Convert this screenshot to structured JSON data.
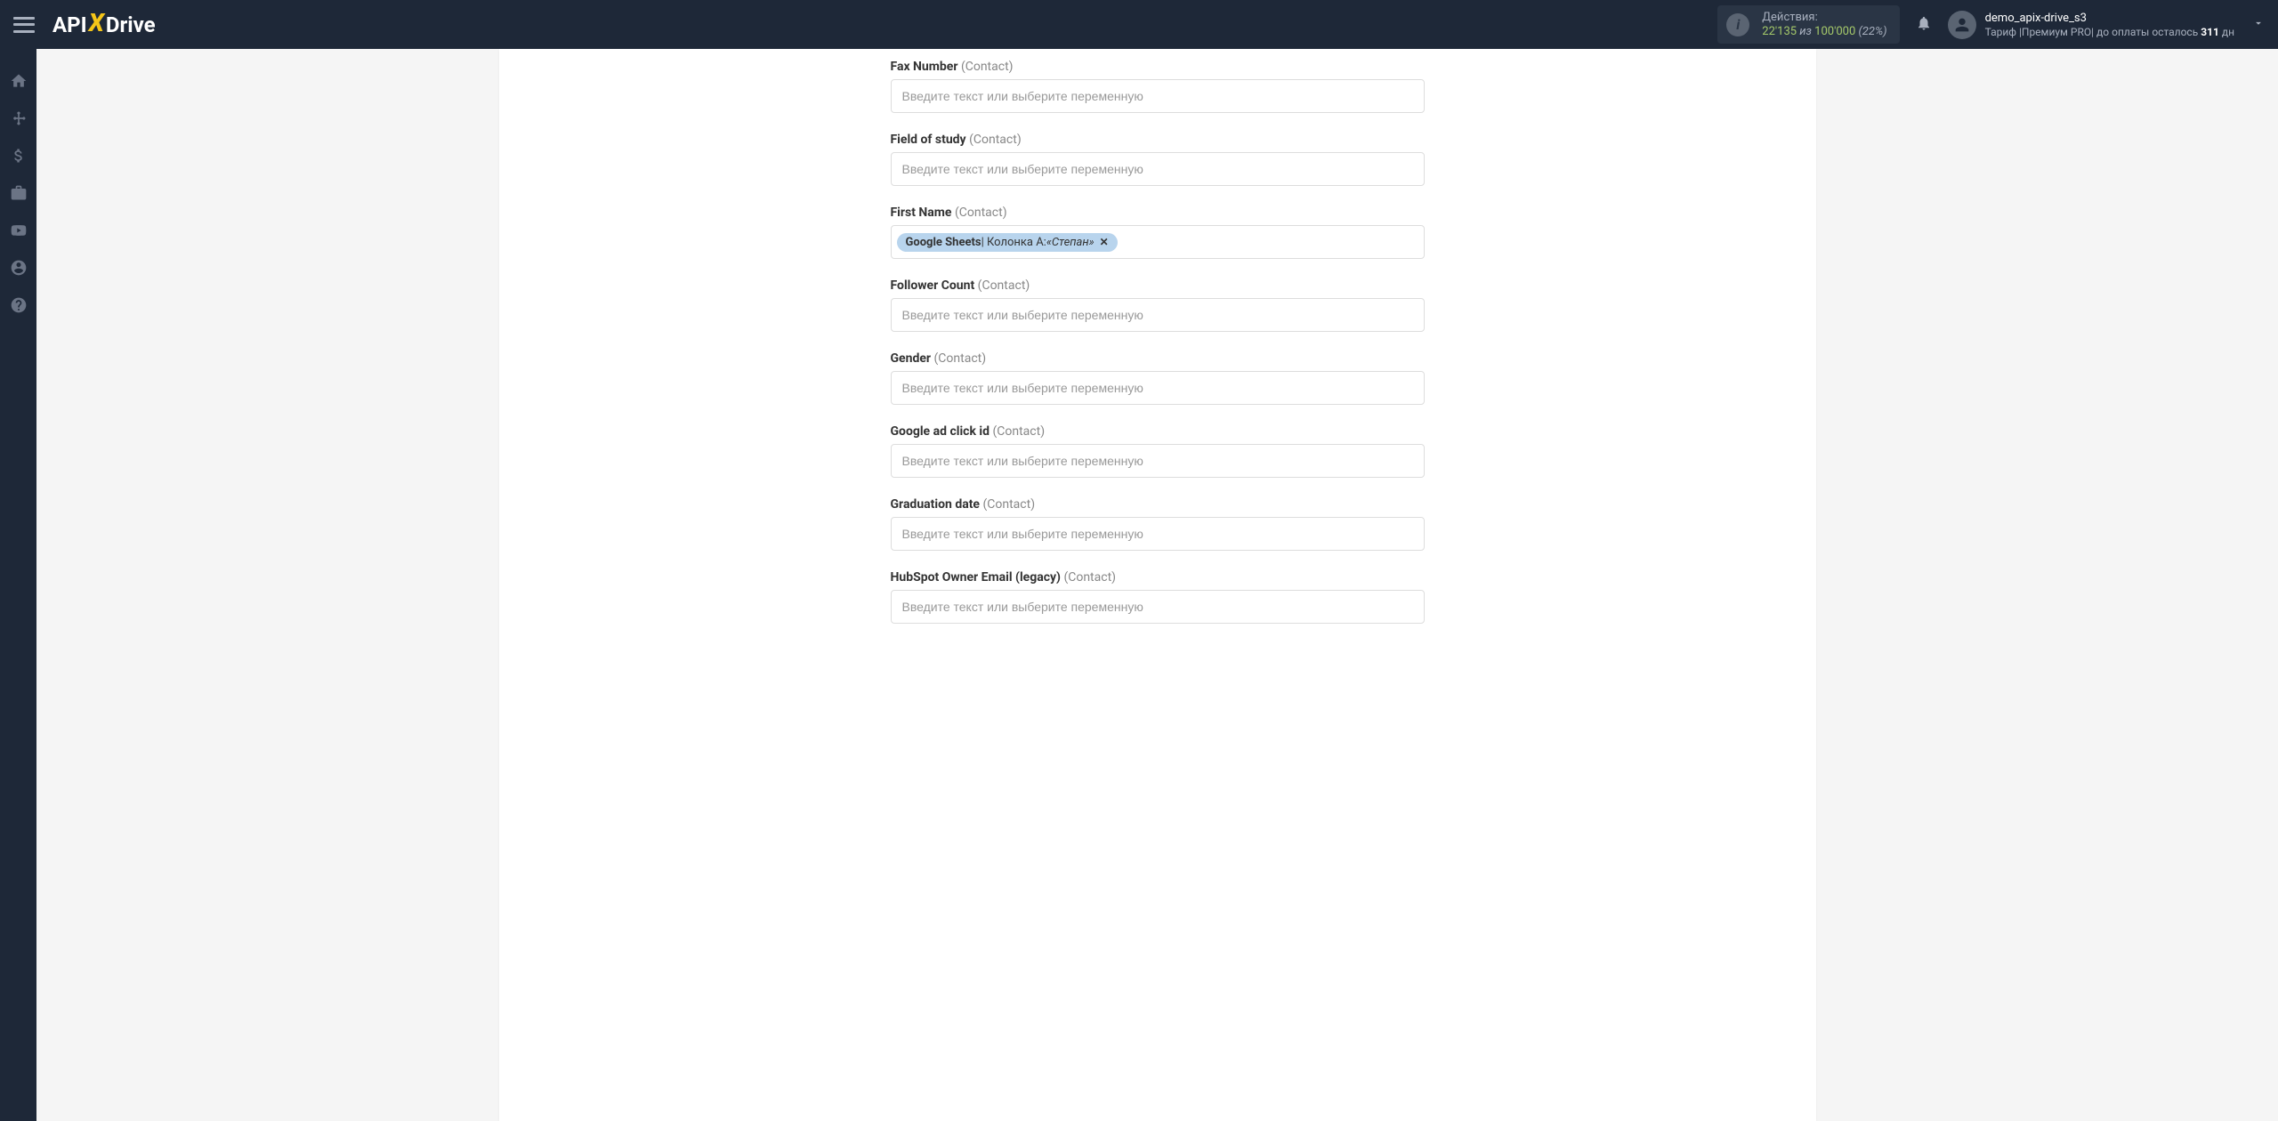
{
  "header": {
    "logo": {
      "api": "API",
      "x": "X",
      "drive": "Drive"
    },
    "actions": {
      "label": "Действия:",
      "current": "22'135",
      "sep": " из ",
      "total": "100'000",
      "pct": " (22%)"
    },
    "user": {
      "name": "demo_apix-drive_s3",
      "tariff_prefix": "Тариф |Премиум PRO| до оплаты осталось ",
      "tariff_days": "311",
      "tariff_suffix": " дн"
    }
  },
  "form": {
    "placeholder": "Введите текст или выберите переменную",
    "fields": [
      {
        "label": "Fax Number",
        "suffix": "(Contact)",
        "tag": null
      },
      {
        "label": "Field of study",
        "suffix": "(Contact)",
        "tag": null
      },
      {
        "label": "First Name",
        "suffix": "(Contact)",
        "tag": {
          "source": "Google Sheets",
          "column": " | Колонка A: ",
          "value": "«Степан»"
        }
      },
      {
        "label": "Follower Count",
        "suffix": "(Contact)",
        "tag": null
      },
      {
        "label": "Gender",
        "suffix": "(Contact)",
        "tag": null
      },
      {
        "label": "Google ad click id",
        "suffix": "(Contact)",
        "tag": null
      },
      {
        "label": "Graduation date",
        "suffix": "(Contact)",
        "tag": null
      },
      {
        "label": "HubSpot Owner Email (legacy)",
        "suffix": "(Contact)",
        "tag": null
      }
    ]
  }
}
